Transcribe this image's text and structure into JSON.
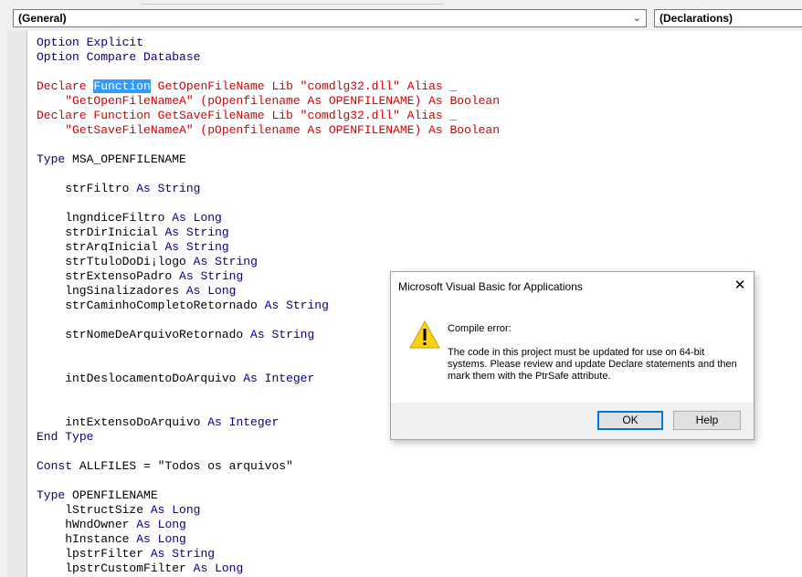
{
  "toolbar": {
    "object_combo": "(General)",
    "procedure_combo": "(Declarations)"
  },
  "code": {
    "lines": [
      [
        "Option Explicit"
      ],
      [
        "Option Compare Database"
      ],
      [
        ""
      ],
      [
        "Declare ",
        "Function",
        " GetOpenFileName Lib \"comdlg32.dll\" Alias _"
      ],
      [
        "    \"GetOpenFileNameA\" (pOpenfilename As OPENFILENAME) As Boolean"
      ],
      [
        "Declare Function GetSaveFileName Lib \"comdlg32.dll\" Alias _"
      ],
      [
        "    \"GetSaveFileNameA\" (pOpenfilename As OPENFILENAME) As Boolean"
      ],
      [
        ""
      ],
      [
        "Type MSA_OPENFILENAME"
      ],
      [
        ""
      ],
      [
        "    strFiltro As String"
      ],
      [
        ""
      ],
      [
        "    lngndiceFiltro As Long"
      ],
      [
        "    strDirInicial As String"
      ],
      [
        "    strArqInicial As String"
      ],
      [
        "    strTtuloDoDi¡logo As String"
      ],
      [
        "    strExtensoPadro As String"
      ],
      [
        "    lngSinalizadores As Long"
      ],
      [
        "    strCaminhoCompletoRetornado As String"
      ],
      [
        ""
      ],
      [
        "    strNomeDeArquivoRetornado As String"
      ],
      [
        ""
      ],
      [
        ""
      ],
      [
        "    intDeslocamentoDoArquivo As Integer"
      ],
      [
        ""
      ],
      [
        ""
      ],
      [
        "    intExtensoDoArquivo As Integer"
      ],
      [
        "End Type"
      ],
      [
        ""
      ],
      [
        "Const ALLFILES = \"Todos os arquivos\""
      ],
      [
        ""
      ],
      [
        "Type OPENFILENAME"
      ],
      [
        "    lStructSize As Long"
      ],
      [
        "    hWndOwner As Long"
      ],
      [
        "    hInstance As Long"
      ],
      [
        "    lpstrFilter As String"
      ],
      [
        "    lpstrCustomFilter As Long"
      ]
    ]
  },
  "dialog": {
    "title": "Microsoft Visual Basic for Applications",
    "close_glyph": "✕",
    "heading": "Compile error:",
    "message": "The code in this project must be updated for use on 64-bit systems.  Please review and update Declare statements and then mark them with the PtrSafe attribute.",
    "ok_label": "OK",
    "help_label": "Help",
    "icon": "warning-icon"
  },
  "colors": {
    "keyword": "#00008b",
    "error_line": "#d40000",
    "selection": "#3399ff",
    "ok_focus": "#0078d7"
  }
}
